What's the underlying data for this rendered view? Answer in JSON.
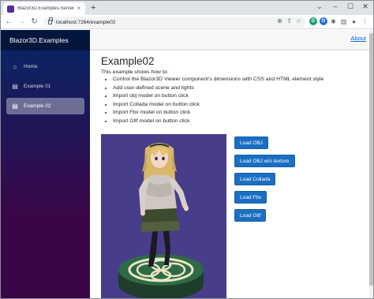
{
  "browser": {
    "tab_title": "Blazor3D.Examples.Server",
    "tab_close": "×",
    "new_tab": "+",
    "url": "localhost:7264/example02",
    "window_controls": {
      "minimize": "–",
      "maximize": "☐",
      "close": "✕"
    },
    "nav": {
      "back": "←",
      "forward": "→",
      "reload": "↻"
    },
    "omnibox_icons": {
      "zoom": "⊕",
      "share": "⇪",
      "bookmark": "☆"
    },
    "extensions": [
      "G",
      "G"
    ],
    "extension_colors": [
      "#1a9e72",
      "#2b6cd8"
    ],
    "toolbar_icons": {
      "extensions": "✱",
      "sidebar": "▥",
      "profile": "●",
      "menu": "⋮"
    }
  },
  "sidebar": {
    "brand": "Blazor3D.Examples",
    "items": [
      {
        "label": "Home",
        "icon": "home-icon",
        "glyph": "⌂",
        "active": false
      },
      {
        "label": "Example 01",
        "icon": "list-icon",
        "glyph": "▤",
        "active": false
      },
      {
        "label": "Example 02",
        "icon": "list-icon",
        "glyph": "▤",
        "active": true
      }
    ]
  },
  "topbar": {
    "about": "About"
  },
  "main": {
    "title": "Example02",
    "intro": "This example shows how to:",
    "bullets": [
      "Control the Blazor3D Viewer component's dimensions with CSS and HTML element style",
      "Add user-defined scene and lights",
      "Import obj model on button click",
      "Import Collada model on button click",
      "Import Fbx model on button click",
      "Import Gltf model on button click"
    ],
    "buttons": [
      "Load OBJ",
      "Load OBJ w/o texture",
      "Load Collada",
      "Load Fbx",
      "Load Gltf"
    ]
  },
  "colors": {
    "viewer_background": "#483d8b",
    "button": "#1b6ec2",
    "link": "#0366d6"
  }
}
